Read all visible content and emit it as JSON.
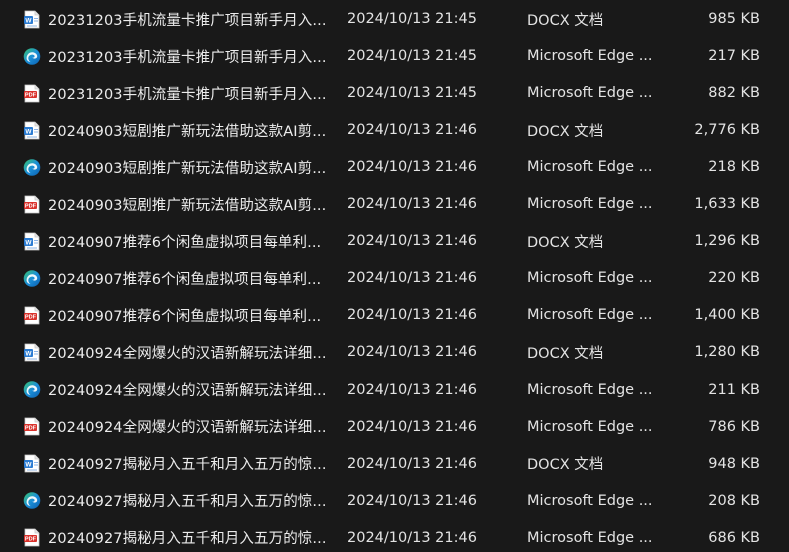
{
  "colors": {
    "background": "#191919",
    "docx_blue": "#2b7cd3",
    "edge_blue": "#1b8fd8",
    "edge_green": "#3bc66b",
    "pdf_red": "#d9312b"
  },
  "files": [
    {
      "icon": "docx",
      "name": "20231203手机流量卡推广项目新手月入...",
      "date": "2024/10/13 21:45",
      "type": "DOCX 文档",
      "size": "985 KB"
    },
    {
      "icon": "edge",
      "name": "20231203手机流量卡推广项目新手月入...",
      "date": "2024/10/13 21:45",
      "type": "Microsoft Edge ...",
      "size": "217 KB"
    },
    {
      "icon": "pdf",
      "name": "20231203手机流量卡推广项目新手月入...",
      "date": "2024/10/13 21:45",
      "type": "Microsoft Edge ...",
      "size": "882 KB"
    },
    {
      "icon": "docx",
      "name": "20240903短剧推广新玩法借助这款AI剪...",
      "date": "2024/10/13 21:46",
      "type": "DOCX 文档",
      "size": "2,776 KB"
    },
    {
      "icon": "edge",
      "name": "20240903短剧推广新玩法借助这款AI剪...",
      "date": "2024/10/13 21:46",
      "type": "Microsoft Edge ...",
      "size": "218 KB"
    },
    {
      "icon": "pdf",
      "name": "20240903短剧推广新玩法借助这款AI剪...",
      "date": "2024/10/13 21:46",
      "type": "Microsoft Edge ...",
      "size": "1,633 KB"
    },
    {
      "icon": "docx",
      "name": "20240907推荐6个闲鱼虚拟项目每单利...",
      "date": "2024/10/13 21:46",
      "type": "DOCX 文档",
      "size": "1,296 KB"
    },
    {
      "icon": "edge",
      "name": "20240907推荐6个闲鱼虚拟项目每单利...",
      "date": "2024/10/13 21:46",
      "type": "Microsoft Edge ...",
      "size": "220 KB"
    },
    {
      "icon": "pdf",
      "name": "20240907推荐6个闲鱼虚拟项目每单利...",
      "date": "2024/10/13 21:46",
      "type": "Microsoft Edge ...",
      "size": "1,400 KB"
    },
    {
      "icon": "docx",
      "name": "20240924全网爆火的汉语新解玩法详细...",
      "date": "2024/10/13 21:46",
      "type": "DOCX 文档",
      "size": "1,280 KB"
    },
    {
      "icon": "edge",
      "name": "20240924全网爆火的汉语新解玩法详细...",
      "date": "2024/10/13 21:46",
      "type": "Microsoft Edge ...",
      "size": "211 KB"
    },
    {
      "icon": "pdf",
      "name": "20240924全网爆火的汉语新解玩法详细...",
      "date": "2024/10/13 21:46",
      "type": "Microsoft Edge ...",
      "size": "786 KB"
    },
    {
      "icon": "docx",
      "name": "20240927揭秘月入五千和月入五万的惊...",
      "date": "2024/10/13 21:46",
      "type": "DOCX 文档",
      "size": "948 KB"
    },
    {
      "icon": "edge",
      "name": "20240927揭秘月入五千和月入五万的惊...",
      "date": "2024/10/13 21:46",
      "type": "Microsoft Edge ...",
      "size": "208 KB"
    },
    {
      "icon": "pdf",
      "name": "20240927揭秘月入五千和月入五万的惊...",
      "date": "2024/10/13 21:46",
      "type": "Microsoft Edge ...",
      "size": "686 KB"
    }
  ]
}
